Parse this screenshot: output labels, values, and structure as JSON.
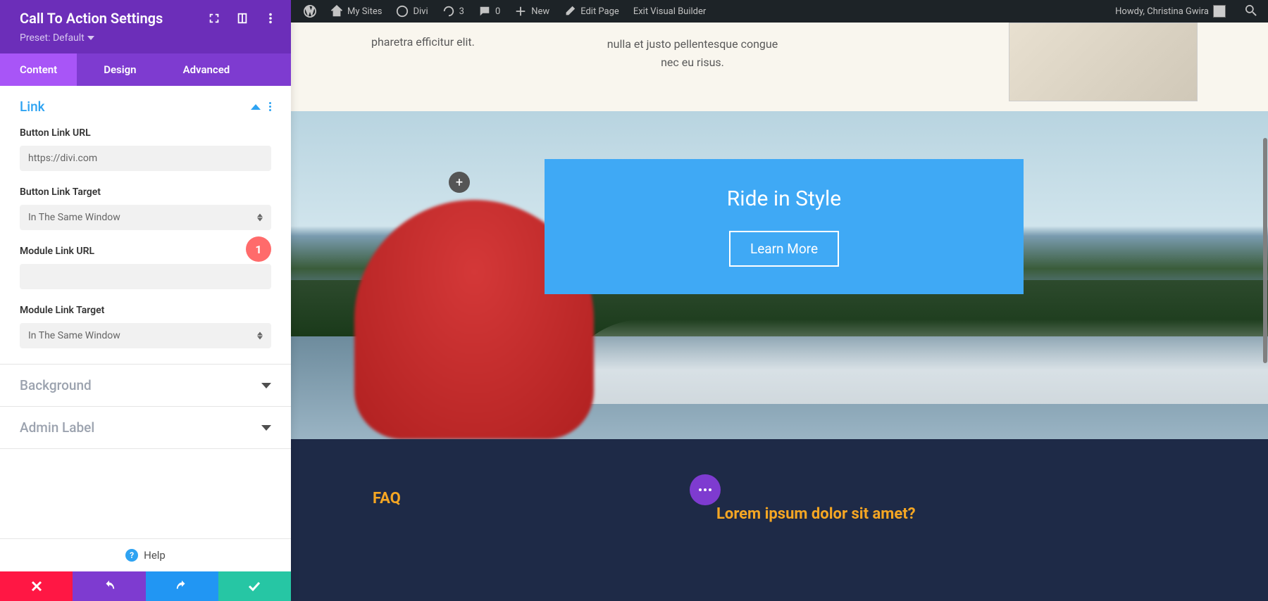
{
  "adminBar": {
    "mySites": "My Sites",
    "divi": "Divi",
    "updates": "3",
    "comments": "0",
    "new": "New",
    "editPage": "Edit Page",
    "exitVB": "Exit Visual Builder",
    "greeting": "Howdy, Christina Gwira"
  },
  "panel": {
    "title": "Call To Action Settings",
    "presetLabel": "Preset: Default",
    "tabs": {
      "content": "Content",
      "design": "Design",
      "advanced": "Advanced"
    },
    "sections": {
      "link": "Link",
      "background": "Background",
      "adminLabel": "Admin Label"
    },
    "fields": {
      "buttonLinkURL": {
        "label": "Button Link URL",
        "value": "https://divi.com"
      },
      "buttonLinkTarget": {
        "label": "Button Link Target",
        "value": "In The Same Window"
      },
      "moduleLinkURL": {
        "label": "Module Link URL",
        "value": ""
      },
      "moduleLinkTarget": {
        "label": "Module Link Target",
        "value": "In The Same Window"
      }
    },
    "calloutNumber": "1",
    "help": "Help"
  },
  "content": {
    "text1": "pharetra efficitur elit.",
    "text2": "nulla et justo pellentesque congue nec eu risus.",
    "cta": {
      "title": "Ride in Style",
      "button": "Learn More"
    },
    "faq": {
      "title": "FAQ",
      "question": "Lorem ipsum dolor sit amet?"
    },
    "addSymbol": "+"
  }
}
